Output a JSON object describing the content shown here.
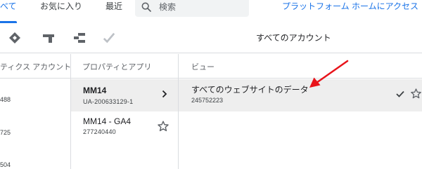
{
  "topbar": {
    "tabs": [
      {
        "label": "べて",
        "active": true
      },
      {
        "label": "お気に入り",
        "active": false
      },
      {
        "label": "最近",
        "active": false
      }
    ],
    "search_placeholder": "検索",
    "platform_link": "プラットフォーム ホームにアクセス"
  },
  "toolbar": {
    "icons": [
      "analytics-account-icon",
      "property-icon",
      "view-icon",
      "check-icon"
    ],
    "title": "すべてのアカウント"
  },
  "columns": {
    "accounts": {
      "header": "ティクス アカウント",
      "items": [
        "488",
        "725",
        "504"
      ]
    },
    "properties": {
      "header": "プロパティとアプリ",
      "items": [
        {
          "name": "MM14",
          "id": "UA-200633129-1",
          "selected": true
        },
        {
          "name": "MM14 - GA4",
          "id": "277240440",
          "selected": false
        }
      ]
    },
    "views": {
      "header": "ビュー",
      "items": [
        {
          "name": "すべてのウェブサイトのデータ",
          "id": "245752223",
          "selected": true
        }
      ]
    }
  },
  "colors": {
    "accent": "#1a73e8",
    "annotation_arrow": "#e8131a",
    "selected_row": "#eeeeee"
  }
}
